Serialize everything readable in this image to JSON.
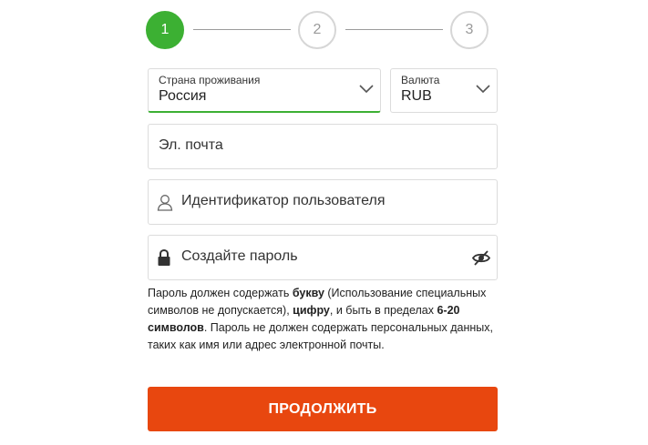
{
  "stepper": {
    "steps": [
      {
        "label": "1",
        "active": true
      },
      {
        "label": "2",
        "active": false
      },
      {
        "label": "3",
        "active": false
      }
    ]
  },
  "country": {
    "label": "Страна проживания",
    "value": "Россия"
  },
  "currency": {
    "label": "Валюта",
    "value": "RUB"
  },
  "email": {
    "placeholder": "Эл. почта"
  },
  "username": {
    "placeholder": "Идентификатор пользователя",
    "icon": "user-icon"
  },
  "password": {
    "placeholder": "Создайте пароль",
    "icon": "lock-icon",
    "toggle_icon": "eye-off-icon"
  },
  "hint": {
    "t1": "Пароль должен содержать ",
    "b1": "букву",
    "t2": " (Использование специальных символов не допускается), ",
    "b2": "цифру",
    "t3": ", и быть в пределах ",
    "b3": "6-20 символов",
    "t4": ". Пароль не должен содержать персональных данных, таких как имя или адрес электронной почты."
  },
  "continue_label": "ПРОДОЛЖИТЬ",
  "colors": {
    "accent_green": "#3cb033",
    "button_orange": "#e8470f",
    "border": "#dcdcdc"
  }
}
